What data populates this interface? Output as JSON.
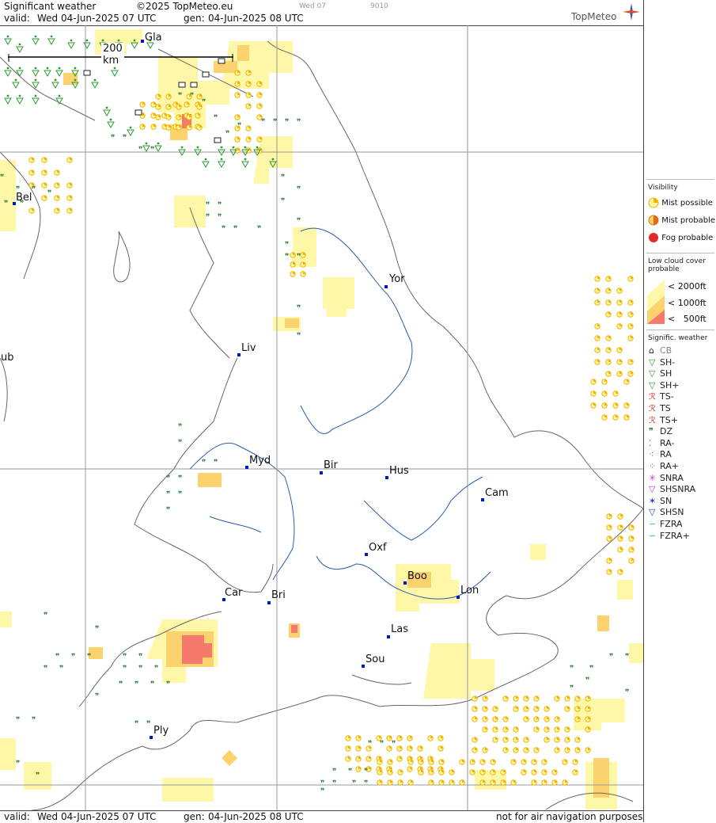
{
  "header": {
    "title": "Significant weather",
    "copyright": "©2025 TopMeteo.eu",
    "day_label": "Wed 07",
    "code": "9010",
    "valid_label": "valid:",
    "valid_value": "Wed  04-Jun-2025  07 UTC",
    "gen_label": "gen:",
    "gen_value": "04-Jun-2025 08 UTC",
    "brand": "TopMeteo"
  },
  "footer": {
    "valid_label": "valid:",
    "valid_value": "Wed  04-Jun-2025  07 UTC",
    "gen_label": "gen:",
    "gen_value": "04-Jun-2025 08 UTC",
    "disclaimer": "not for air navigation purposes"
  },
  "map": {
    "scale_label": "200 km",
    "cities": [
      "Gla",
      "Bel",
      "ub",
      "Yor",
      "Liv",
      "Myd",
      "Bir",
      "Hus",
      "Cam",
      "Oxf",
      "Boo",
      "Lon",
      "Car",
      "Bri",
      "Las",
      "Sou",
      "Ply"
    ]
  },
  "legend": {
    "visibility_title": "Visibility",
    "visibility": [
      "Mist possible",
      "Mist probable",
      "Fog probable"
    ],
    "lowcloud_title": "Low cloud cover probable",
    "lowcloud": [
      "< 2000ft",
      "< 1000ft",
      "<   500ft"
    ],
    "sigwx_title": "Signific. weather",
    "sigwx": [
      "CB",
      "SH-",
      "SH",
      "SH+",
      "TS-",
      "TS",
      "TS+",
      "DZ",
      "RA-",
      "RA",
      "RA+",
      "SNRA",
      "SHSNRA",
      "SN",
      "SHSN",
      "FZRA",
      "FZRA+"
    ]
  },
  "colors": {
    "low_cloud_2000": "#fff7a8",
    "low_cloud_1000": "#fbd26e",
    "low_cloud_500": "#f47a6c",
    "fog": "#e02a2a",
    "mist": "#f2b400",
    "showers": "#2e9b2e",
    "rivers": "#2a5caa",
    "coast": "#666666",
    "city": "#0018c8"
  }
}
